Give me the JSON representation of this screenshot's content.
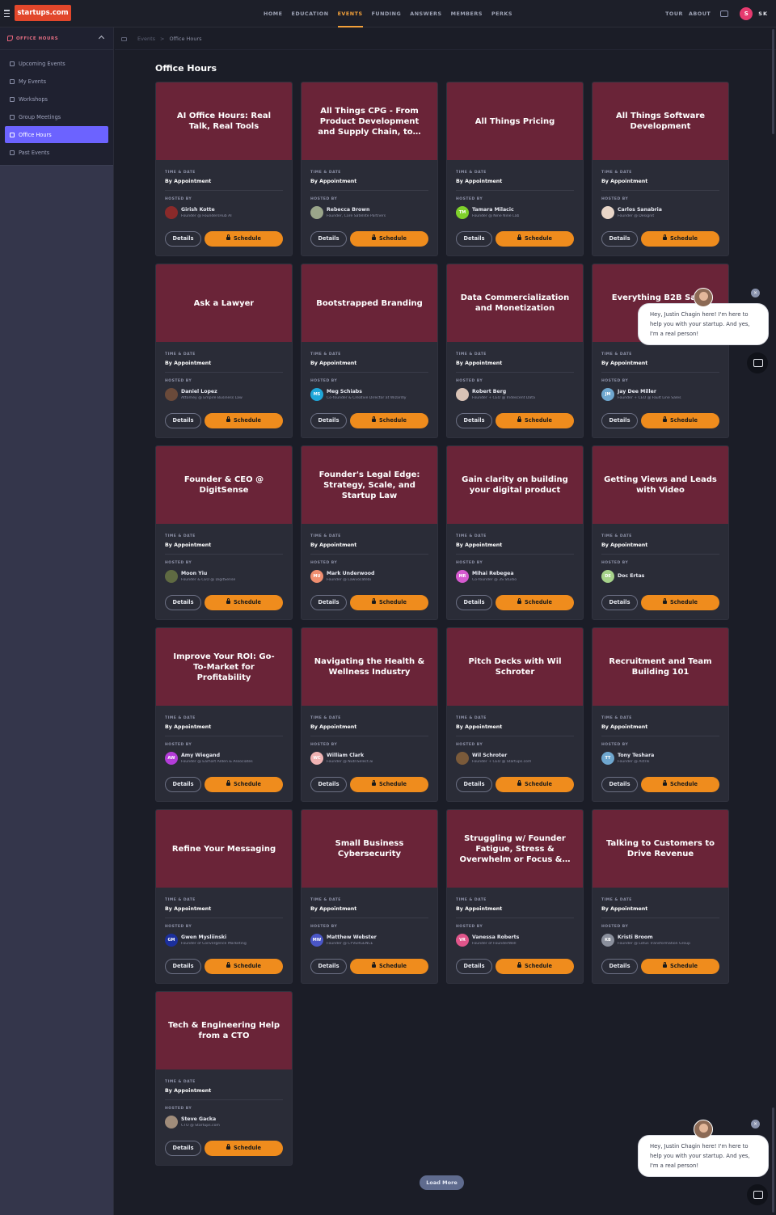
{
  "topnav": {
    "logo": "startups.com",
    "links": [
      "HOME",
      "EDUCATION",
      "EVENTS",
      "FUNDING",
      "ANSWERS",
      "MEMBERS",
      "PERKS"
    ],
    "active_index": 2,
    "right_links": [
      "TOUR",
      "ABOUT"
    ],
    "avatar_letter": "S",
    "initials": "SK"
  },
  "sidebar": {
    "section_label": "OFFICE HOURS",
    "items": [
      {
        "label": "Upcoming Events",
        "icon": "calendar-icon"
      },
      {
        "label": "My Events",
        "icon": "calendar-icon"
      },
      {
        "label": "Workshops",
        "icon": "tools-icon"
      },
      {
        "label": "Group Meetings",
        "icon": "people-icon"
      },
      {
        "label": "Office Hours",
        "icon": "phone-icon",
        "active": true
      },
      {
        "label": "Past Events",
        "icon": "clock-icon"
      }
    ]
  },
  "breadcrumb": {
    "root": "Events",
    "separator": ">",
    "current": "Office Hours"
  },
  "page_title": "Office Hours",
  "labels": {
    "time_date": "TIME & DATE",
    "hosted_by": "HOSTED BY",
    "details": "Details",
    "schedule": "Schedule",
    "load_more": "Load More"
  },
  "cards": [
    {
      "title": "AI Office Hours: Real Talk, Real Tools",
      "time": "By Appointment",
      "host": "Girish Kotte",
      "host_title": "Founder @ FoundersHub AI",
      "avatar_color": "#8a2a2a",
      "initials": ""
    },
    {
      "title": "All Things CPG - From Product Development and Supply Chain, to…",
      "time": "By Appointment",
      "host": "Rebecca Brown",
      "host_title": "Founder, Core Satellite Partners",
      "avatar_color": "#9aa58a",
      "initials": ""
    },
    {
      "title": "All Things Pricing",
      "time": "By Appointment",
      "host": "Tamara Milacic",
      "host_title": "Founder @ Nine Nine Lab",
      "avatar_color": "#7fd12b",
      "initials": "TM"
    },
    {
      "title": "All Things Software Development",
      "time": "By Appointment",
      "host": "Carlos Sanabria",
      "host_title": "Founder @ Designit",
      "avatar_color": "#e9d6c8",
      "initials": ""
    },
    {
      "title": "Ask a Lawyer",
      "time": "By Appointment",
      "host": "Daniel Lopez",
      "host_title": "Attorney @ Empire Business Law",
      "avatar_color": "#6a4a3a",
      "initials": ""
    },
    {
      "title": "Bootstrapped Branding",
      "time": "By Appointment",
      "host": "Meg Schiabs",
      "host_title": "Co-founder & Creative Director at Wizardly",
      "avatar_color": "#1fa6d8",
      "initials": "MS"
    },
    {
      "title": "Data Commercialization and Monetization",
      "time": "By Appointment",
      "host": "Robert Berg",
      "host_title": "Founder + CEO @ Iridescent Data",
      "avatar_color": "#d9c3b6",
      "initials": ""
    },
    {
      "title": "Everything B2B Sales Jo…",
      "time": "By Appointment",
      "host": "Jay Dee Miller",
      "host_title": "Founder + CEO @ Fault Line Sales",
      "avatar_color": "#6fa7cf",
      "initials": "JM"
    },
    {
      "title": "Founder & CEO @ DigitSense",
      "time": "By Appointment",
      "host": "Moon Yiu",
      "host_title": "Founder & CEO @ DigitSense",
      "avatar_color": "#5f6a42",
      "initials": ""
    },
    {
      "title": "Founder's Legal Edge: Strategy, Scale, and Startup Law",
      "time": "By Appointment",
      "host": "Mark Underwood",
      "host_title": "Founder @ Lawvocatebi",
      "avatar_color": "#f08e6f",
      "initials": "MU"
    },
    {
      "title": "Gain clarity on building your digital product",
      "time": "By Appointment",
      "host": "Mihai Rebegea",
      "host_title": "Co-founder @ 3S Studio",
      "avatar_color": "#d65ad0",
      "initials": "MR"
    },
    {
      "title": "Getting Views and Leads with Video",
      "time": "By Appointment",
      "host": "Doc Ertas",
      "host_title": "",
      "avatar_color": "#a6d28a",
      "initials": "DE"
    },
    {
      "title": "Improve Your ROI: Go-To-Market for Profitability",
      "time": "By Appointment",
      "host": "Amy Wiegand",
      "host_title": "Founder @ Earhart Alden & Associates",
      "avatar_color": "#b33cd8",
      "initials": "AW"
    },
    {
      "title": "Navigating the Health & Wellness Industry",
      "time": "By Appointment",
      "host": "William Clark",
      "host_title": "Founder @ NutriSelect.ai",
      "avatar_color": "#f0b3b3",
      "initials": "WC"
    },
    {
      "title": "Pitch Decks with Wil Schroter",
      "time": "By Appointment",
      "host": "Wil Schroter",
      "host_title": "Founder + CEO @ Startups.com",
      "avatar_color": "#7a5a3a",
      "initials": ""
    },
    {
      "title": "Recruitment and Team Building 101",
      "time": "By Appointment",
      "host": "Tony Teshara",
      "host_title": "Founder @ Astrik",
      "avatar_color": "#6fa7cf",
      "initials": "TT"
    },
    {
      "title": "Refine Your Messaging",
      "time": "By Appointment",
      "host": "Gwen Mysliinski",
      "host_title": "Founder of Convergence Marketing",
      "avatar_color": "#1b2f9c",
      "initials": "GM"
    },
    {
      "title": "Small Business Cybersecurity",
      "time": "By Appointment",
      "host": "Matthew Webster",
      "host_title": "Founder @ CYVERGENCE",
      "avatar_color": "#4a56c7",
      "initials": "MW"
    },
    {
      "title": "Struggling w/ Founder Fatigue, Stress & Overwhelm or Focus &…",
      "time": "By Appointment",
      "host": "Vanessa Roberts",
      "host_title": "Founder of FounderWell",
      "avatar_color": "#e0558a",
      "initials": "VR"
    },
    {
      "title": "Talking to Customers to Drive Revenue",
      "time": "By Appointment",
      "host": "Kristi Broom",
      "host_title": "Founder @ Lotus Transformation Group",
      "avatar_color": "#8a8f9c",
      "initials": "KB"
    },
    {
      "title": "Tech & Engineering Help from a CTO",
      "time": "By Appointment",
      "host": "Steve Gacka",
      "host_title": "CTO @ Startups.com",
      "avatar_color": "#a08c7a",
      "initials": ""
    }
  ],
  "chat": {
    "message": "Hey, Justin Chagin here! I'm here to help you with your startup. And yes, I'm a real person!",
    "close_glyph": "×"
  }
}
